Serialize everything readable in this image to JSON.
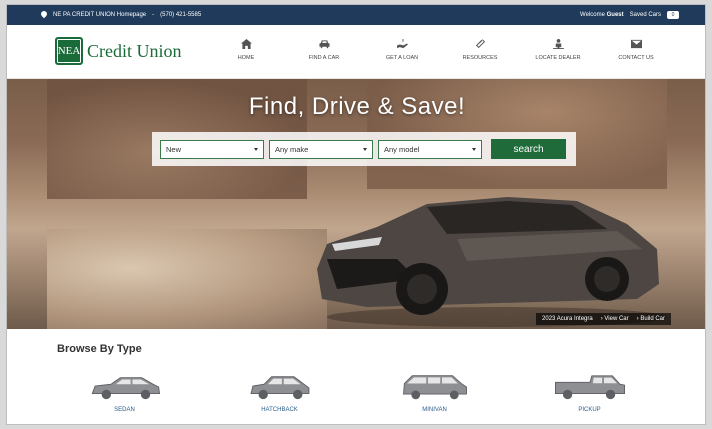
{
  "topbar": {
    "homepage_link": "NE PA CREDIT UNION Homepage",
    "separator": "-",
    "phone": "(570) 421-5585",
    "welcome_prefix": "Welcome",
    "welcome_user": "Guest",
    "saved_cars_label": "Saved Cars",
    "saved_cars_count": "0"
  },
  "logo": {
    "mark": "NEA",
    "text": "Credit Union"
  },
  "nav": [
    {
      "label": "HOME",
      "icon": "home-icon"
    },
    {
      "label": "FIND A CAR",
      "icon": "car-icon"
    },
    {
      "label": "GET A LOAN",
      "icon": "loan-hand-icon"
    },
    {
      "label": "RESOURCES",
      "icon": "paperclip-icon"
    },
    {
      "label": "LOCATE DEALER",
      "icon": "dealer-person-icon"
    },
    {
      "label": "CONTACT US",
      "icon": "envelope-icon"
    }
  ],
  "hero": {
    "title": "Find, Drive & Save!",
    "condition_select": "New",
    "make_select": "Any make",
    "model_select": "Any model",
    "search_label": "search",
    "caption_car": "2023 Acura Integra",
    "caption_view": "View Car",
    "caption_build": "Build Car"
  },
  "browse": {
    "title": "Browse By Type",
    "types": [
      {
        "label": "SEDAN"
      },
      {
        "label": "HATCHBACK"
      },
      {
        "label": "MINIVAN"
      },
      {
        "label": "PICKUP"
      }
    ]
  },
  "colors": {
    "topbar": "#1f3a5a",
    "brand_green": "#1a6b3a",
    "link_blue": "#2a5c8a"
  }
}
